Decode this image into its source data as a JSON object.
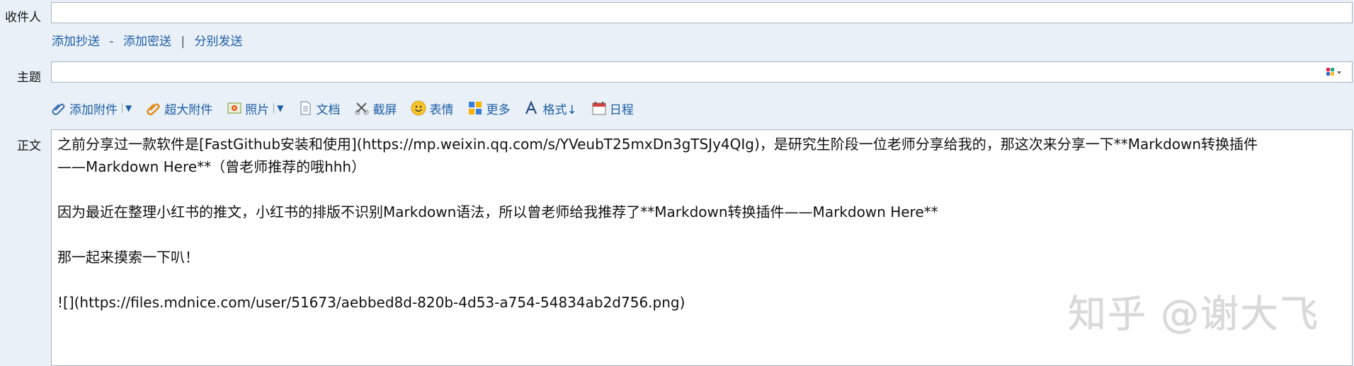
{
  "recipients": {
    "label": "收件人",
    "value": ""
  },
  "recipient_links": {
    "cc": "添加抄送",
    "dash": "-",
    "bcc": "添加密送",
    "pipe": "|",
    "separate": "分别发送"
  },
  "subject": {
    "label": "主题",
    "value": ""
  },
  "toolbar": {
    "attach": "添加附件",
    "large_attach": "超大附件",
    "photo": "照片",
    "doc": "文档",
    "screenshot": "截屏",
    "emoji": "表情",
    "more": "更多",
    "format": "格式↓",
    "calendar": "日程"
  },
  "body": {
    "label": "正文",
    "line1": "之前分享过一款软件是[FastGithub安装和使用](https://mp.weixin.qq.com/s/YVeubT25mxDn3gTSJy4QIg)，是研究生阶段一位老师分享给我的，那这次来分享一下**Markdown转换插件",
    "line2": "——Markdown Here**（曾老师推荐的哦hhh）",
    "line3": "因为最近在整理小红书的推文，小红书的排版不识别Markdown语法，所以曾老师给我推荐了**Markdown转换插件——Markdown Here**",
    "line4": "那一起来摸索一下叭！",
    "line5": "![](https://files.mdnice.com/user/51673/aebbed8d-820b-4d53-a754-54834ab2d756.png)"
  },
  "watermark": "知乎 @谢大飞",
  "colors": {
    "link": "#1f5fa6",
    "background": "#e9f0f7",
    "border": "#a9b3bf"
  }
}
